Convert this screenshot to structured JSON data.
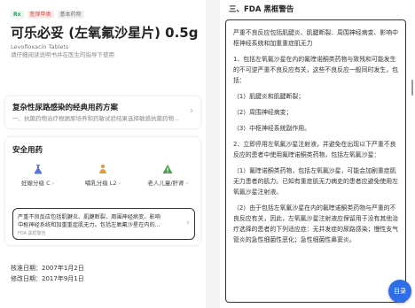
{
  "product": {
    "tags": [
      "Rx",
      "医保甲类",
      "基本药物"
    ],
    "name": "可乐必妥 (左氧氟沙星片) 0.5g",
    "english": "Levofloxacin Tablets",
    "instruction": "请仔细阅读说明书并在医生的指导下使用"
  },
  "drug_card": {
    "title": "复杂性尿路感染的经典用药方案",
    "desc": "一、抗菌药物治疗根据尿培养和药敏试验结果选择敏感抗菌药物..."
  },
  "safety": {
    "title": "安全用药",
    "groups": [
      {
        "label": "妊娠分级 C",
        "icon": "flask-icon",
        "color": "#5b74d8"
      },
      {
        "label": "哺乳分级 L2",
        "icon": "mother-baby-icon",
        "color": "#e59a3a"
      },
      {
        "label": "老人儿童/肝肾",
        "icon": "warning-triangle-icon",
        "color": "#43a047"
      }
    ],
    "warning_line1": "严重不良反应包括肌腱炎、肌腱断裂、周围神经病变、影响",
    "warning_line2": "中枢神经系统和加重重症肌无力。包括左氧氟沙星在内的...",
    "warning_source": "FDA 黑框警告"
  },
  "dates": {
    "approved": "核准日期：2007年1月2日",
    "revised": "修改日期：2017年9月1日"
  },
  "fda": {
    "heading": "三、FDA 黑框警告",
    "paragraphs": [
      "严重不良反应包括肌腱炎、肌腱断裂、周围神经病变、影响中枢神经系统和加重重症肌无力",
      "1、包括左氧氟沙星在内的氟喹诺酮类药物与致残和可能发生的不可逆严重不良反应有关，这些不良反应一般同时发生，包括：",
      "（1）肌腱炎和肌腱断裂；",
      "（2）周围神经病变；",
      "（3）中枢神经系统副作用。",
      "2、立即停用左氧氟沙星注射液，并避免在出现以下严重不良反应的患者中使用氟喹诺酮类药物，包括左氧氟沙星：",
      "（1）氟喹诺酮类药物，包括左氧氟沙星，可能会加剧重症肌无力患者的肌力。已知有重症肌无力病史的患者应避免使用左氧氟沙星注射液。",
      "（2）由于包括左氧氟沙星在内的氟喹诺酮类药物与严重的不良反应有关，因此，左氧氟沙星注射液应保留用于没有其他治疗选择的患者的下列适应症：无并发症的尿路感染；慢性支气管炎的急性细菌性恶化；急性细菌性鼻窦炎。"
    ],
    "fab_label": "目录"
  }
}
